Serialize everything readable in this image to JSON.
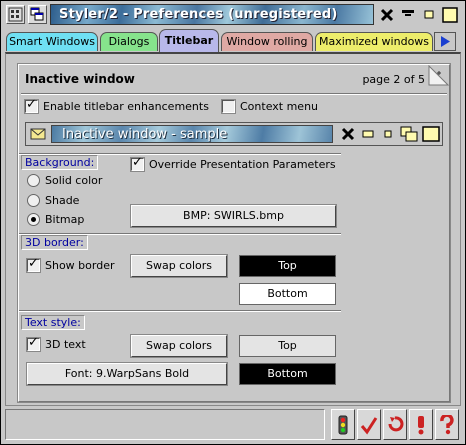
{
  "window": {
    "title": "Styler/2 - Preferences (unregistered)"
  },
  "tabs": [
    {
      "label": "Smart Windows",
      "color": "#6fe0f3"
    },
    {
      "label": "Dialogs",
      "color": "#86e38c"
    },
    {
      "label": "Titlebar",
      "color": "#b8b8ea"
    },
    {
      "label": "Window rolling",
      "color": "#dfa9a4"
    },
    {
      "label": "Maximized windows",
      "color": "#eded6b"
    }
  ],
  "page": {
    "title": "Inactive window",
    "page_indicator": "page 2 of 5"
  },
  "options": {
    "enable_titlebar": {
      "label": "Enable titlebar enhancements",
      "checked": true
    },
    "context_menu": {
      "label": "Context menu",
      "checked": false
    }
  },
  "sample": {
    "text": "Inactive window - sample"
  },
  "background": {
    "group_label": "Background:",
    "override_label": "Override Presentation Parameters",
    "override_checked": true,
    "radio_solid": "Solid color",
    "radio_shade": "Shade",
    "radio_bitmap": "Bitmap",
    "selected": "Bitmap",
    "bitmap_button": "BMP: SWIRLS.bmp"
  },
  "border3d": {
    "group_label": "3D border:",
    "show_border_label": "Show border",
    "show_border_checked": true,
    "swap_label": "Swap colors",
    "top_label": "Top",
    "bottom_label": "Bottom"
  },
  "textstyle": {
    "group_label": "Text style:",
    "text3d_label": "3D text",
    "text3d_checked": true,
    "swap_label": "Swap colors",
    "top_label": "Top",
    "bottom_label": "Bottom",
    "font_button": "Font: 9.WarpSans Bold"
  },
  "colors": {
    "accent_label": "#0000a0",
    "swatch_black": "#000000",
    "swatch_white": "#ffffff"
  }
}
